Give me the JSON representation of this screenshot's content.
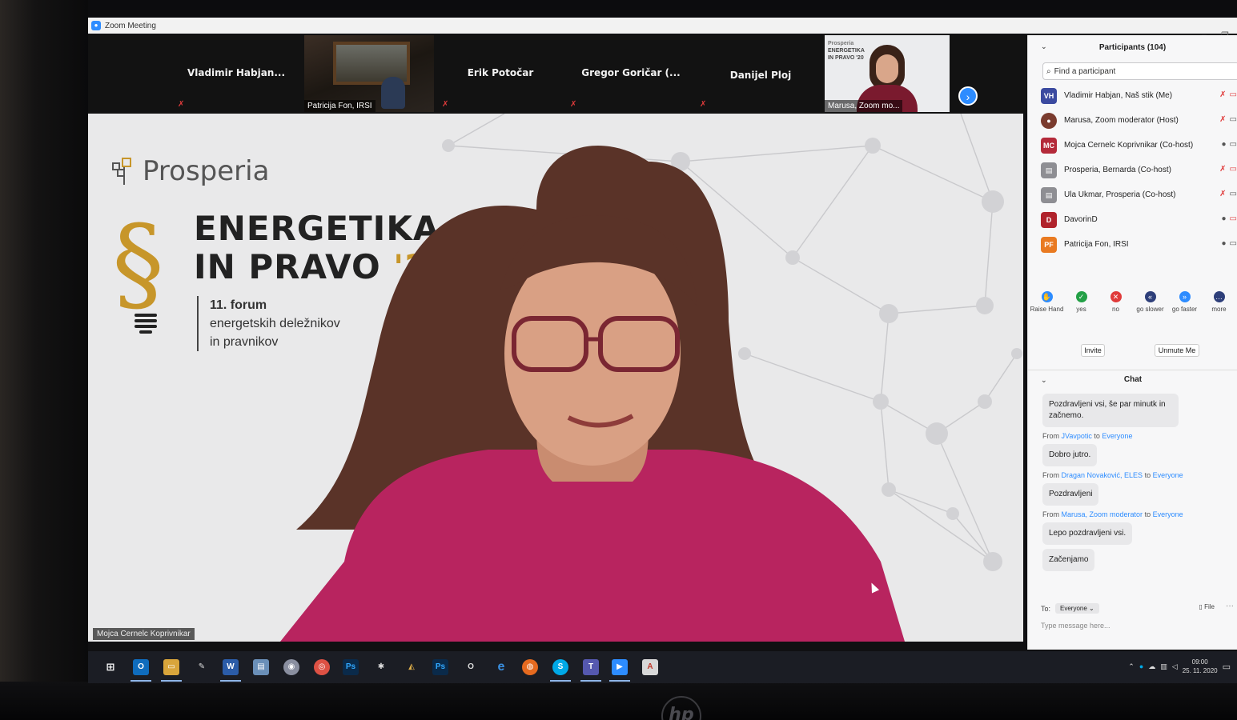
{
  "window": {
    "title": "Zoom Meeting"
  },
  "video_strip": {
    "tiles": [
      {
        "name": "Vladimir  Habjan...",
        "muted": true
      },
      {
        "name": "Patricija Fon, IRSI",
        "muted": true,
        "video": true
      },
      {
        "name": "Erik Potočar",
        "muted": true
      },
      {
        "name": "Gregor Goričar  (...",
        "muted": true
      },
      {
        "name": "Danijel Ploj",
        "muted": true
      },
      {
        "name": "Marusa, Zoom mo...",
        "muted": true,
        "video": true
      }
    ],
    "marusa_slide_text": [
      "Prosperia",
      "ENERGETIKA",
      "IN PRAVO '20"
    ]
  },
  "main_video": {
    "brand": "Prosperia",
    "title_line1": "ENERGETIKA",
    "title_line2": "IN PRAVO",
    "title_year": "'20",
    "section_symbol": "§",
    "forum_line1": "11. forum",
    "forum_line2": "energetskih deležnikov",
    "forum_line3": "in pravnikov",
    "speaker_name": "Mojca Cernelc Koprivnikar",
    "colors": {
      "accent_gold": "#c7962a",
      "sweater": "#b8245f",
      "hair": "#5a3328"
    }
  },
  "participants": {
    "header": "Participants (104)",
    "search_placeholder": "Find a participant",
    "list": [
      {
        "initials": "VH",
        "name": "Vladimir Habjan, Naš stik (Me)",
        "color": "#3b4aa0",
        "mic": "off"
      },
      {
        "initials": "",
        "name": "Marusa, Zoom moderator (Host)",
        "color": "#7a3b2e",
        "mic": "off"
      },
      {
        "initials": "MC",
        "name": "Mojca Cernelc Koprivnikar (Co-host)",
        "color": "#b42a3a",
        "mic": "on"
      },
      {
        "initials": "",
        "name": "Prosperia, Bernarda (Co-host)",
        "color": "#8e8e93",
        "mic": "off"
      },
      {
        "initials": "",
        "name": "Ula Ukmar, Prosperia (Co-host)",
        "color": "#8e8e93",
        "mic": "off"
      },
      {
        "initials": "D",
        "name": "DavorinD",
        "color": "#b0232c",
        "mic": "on"
      },
      {
        "initials": "PF",
        "name": "Patricija Fon, IRSI",
        "color": "#e97a21",
        "mic": "on"
      }
    ],
    "reactions": [
      {
        "label": "Raise Hand",
        "color": "#2d8cff",
        "icon": "hand-icon"
      },
      {
        "label": "yes",
        "color": "#23a046",
        "icon": "check-icon"
      },
      {
        "label": "no",
        "color": "#e03b3b",
        "icon": "x-icon"
      },
      {
        "label": "go slower",
        "color": "#2e3f7a",
        "icon": "rewind-icon"
      },
      {
        "label": "go faster",
        "color": "#2d8cff",
        "icon": "fast-forward-icon"
      },
      {
        "label": "more",
        "color": "#2e3f7a",
        "icon": "more-icon"
      }
    ],
    "invite_label": "Invite",
    "unmute_label": "Unmute Me"
  },
  "chat": {
    "header": "Chat",
    "messages": [
      {
        "from": "",
        "to": "",
        "text": "Pozdravljeni vsi, še par minutk in začnemo."
      },
      {
        "from": "JVavpotic",
        "to": "Everyone",
        "text": "Dobro jutro."
      },
      {
        "from": "Dragan Novaković, ELES",
        "to": "Everyone",
        "text": "Pozdravljeni"
      },
      {
        "from": "Marusa, Zoom moderator",
        "to": "Everyone",
        "text": "Lepo pozdravljeni vsi."
      },
      {
        "from": "",
        "to": "",
        "text": "Začenjamo"
      }
    ],
    "from_prefix": "From",
    "to_word": "to",
    "to_label": "To:",
    "to_value": "Everyone",
    "file_label": "File",
    "input_placeholder": "Type message here..."
  },
  "taskbar": {
    "icons": [
      "windows-start",
      "outlook",
      "file-explorer",
      "pen",
      "word",
      "notepad",
      "app-bubble",
      "chrome",
      "photoshop",
      "satellite",
      "tool",
      "photoshop-2",
      "office",
      "edge",
      "firefox",
      "skype",
      "teams",
      "zoom",
      "acrobat"
    ],
    "time": "09:00",
    "date": "25. 11. 2020"
  }
}
